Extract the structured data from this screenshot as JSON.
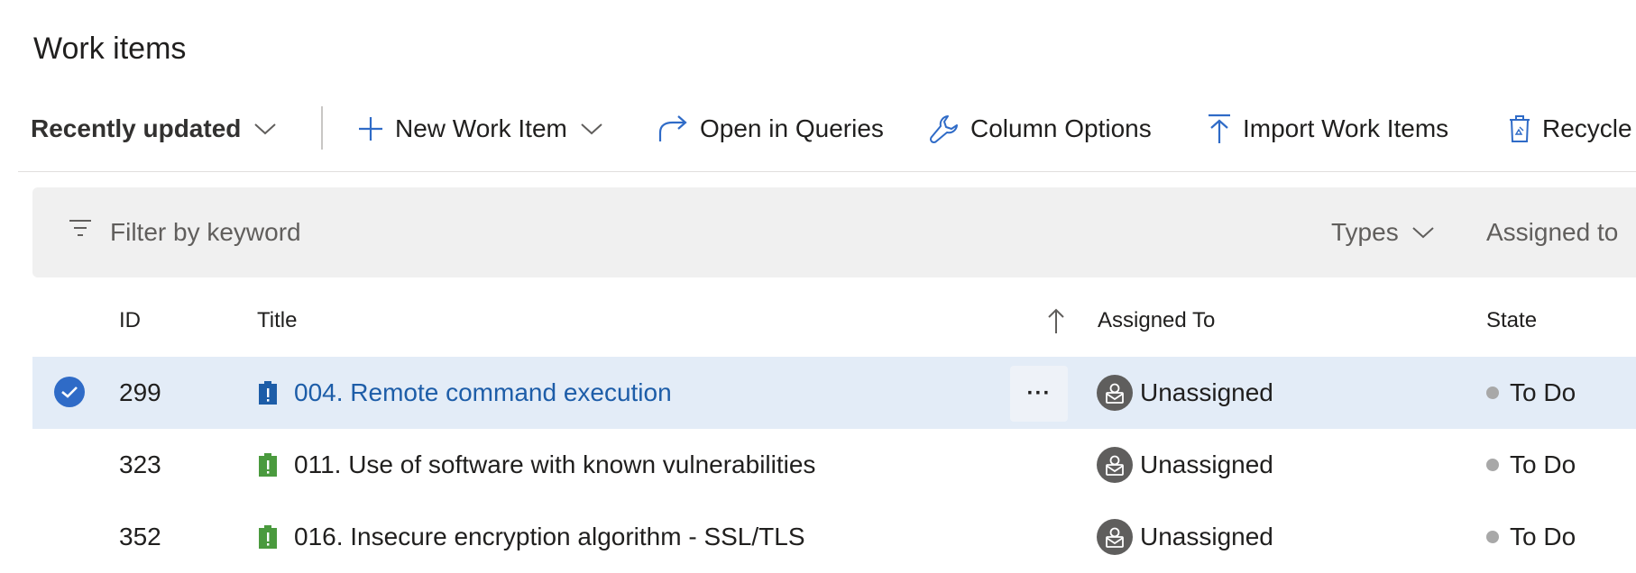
{
  "page": {
    "title": "Work items"
  },
  "toolbar": {
    "view_label": "Recently updated",
    "new_work_item_label": "New Work Item",
    "open_in_queries_label": "Open in Queries",
    "column_options_label": "Column Options",
    "import_label": "Import Work Items",
    "recycle_label": "Recycle Bin"
  },
  "filter": {
    "placeholder": "Filter by keyword",
    "types_label": "Types",
    "assigned_label": "Assigned to"
  },
  "table": {
    "columns": {
      "id": "ID",
      "title": "Title",
      "assigned": "Assigned To",
      "state": "State"
    },
    "rows": [
      {
        "id": "299",
        "title": "004. Remote command execution",
        "assigned": "Unassigned",
        "state": "To Do",
        "selected": true,
        "icon_color": "#1d5da8"
      },
      {
        "id": "323",
        "title": "011. Use of software with known vulnerabilities",
        "assigned": "Unassigned",
        "state": "To Do",
        "selected": false,
        "icon_color": "#4a9a3e"
      },
      {
        "id": "352",
        "title": "016. Insecure encryption algorithm - SSL/TLS",
        "assigned": "Unassigned",
        "state": "To Do",
        "selected": false,
        "icon_color": "#4a9a3e"
      }
    ]
  },
  "colors": {
    "accent": "#2f6bc7",
    "link": "#1d5da8",
    "selected_row": "#e3ecf7",
    "filter_bg": "#f0f0f0",
    "state_dot": "#a8a8a8",
    "avatar_bg": "#5f5e5d"
  },
  "icons": {
    "toolbar": [
      "chevron-down-icon",
      "plus-icon",
      "redirect-arrow-icon",
      "wrench-icon",
      "upload-icon",
      "recycle-bin-icon"
    ],
    "filter": "filter-icon",
    "sort": "sort-ascending-icon",
    "work_item": "issue-icon",
    "avatar": "unassigned-avatar-icon",
    "selected": "checkmark-icon",
    "more": "more-options-icon"
  }
}
